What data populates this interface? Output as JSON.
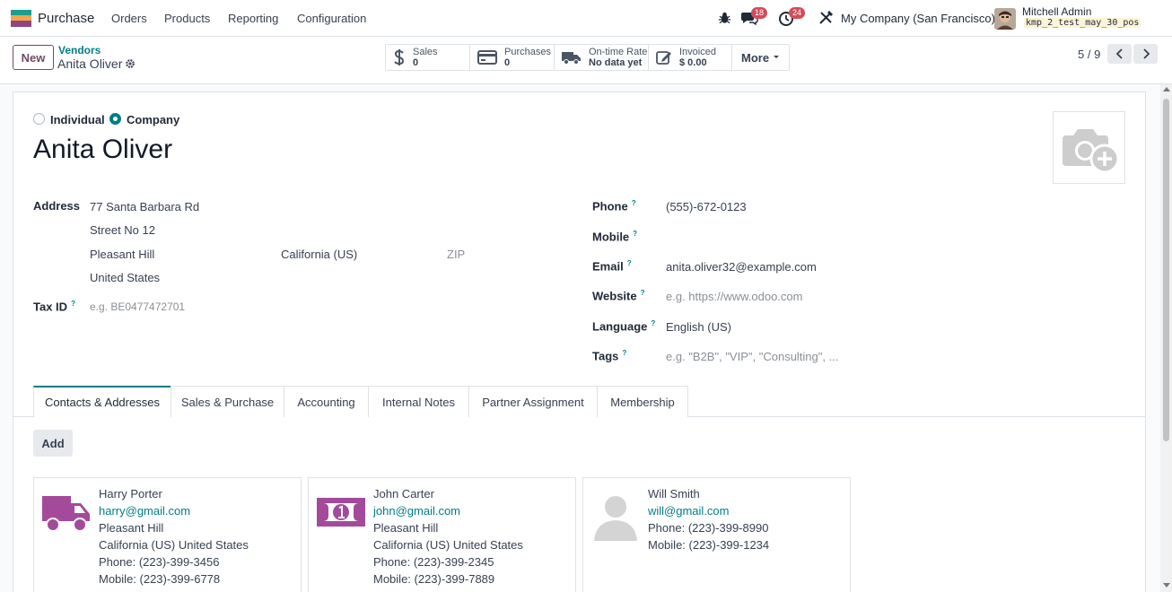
{
  "navbar": {
    "app_name": "Purchase",
    "menu": [
      "Orders",
      "Products",
      "Reporting",
      "Configuration"
    ],
    "icons": [
      "bug-icon",
      "chat-icon",
      "activity-clock-icon",
      "tools-icon"
    ],
    "chat_badge": "18",
    "activity_badge": "24",
    "company": "My Company (San Francisco)",
    "user_name": "Mitchell Admin",
    "db_name": "kmp_2_test_may_30_pos"
  },
  "control": {
    "new_label": "New",
    "breadcrumb_parent": "Vendors",
    "breadcrumb_current": "Anita Oliver",
    "smart_buttons": [
      {
        "icon": "dollar-icon",
        "label": "Sales",
        "value": "0"
      },
      {
        "icon": "credit-card-icon",
        "label": "Purchases",
        "value": "0"
      },
      {
        "icon": "truck-icon",
        "label": "On-time Rate",
        "value": "No data yet"
      },
      {
        "icon": "pencil-square-icon",
        "label": "Invoiced",
        "value": "$ 0.00"
      }
    ],
    "more_label": "More",
    "pager": "5 / 9"
  },
  "form": {
    "type_options": [
      "Individual",
      "Company"
    ],
    "type_selected": "Company",
    "name": "Anita Oliver",
    "address_label": "Address",
    "street": "77 Santa Barbara Rd",
    "street2": "Street No 12",
    "city": "Pleasant Hill",
    "state": "California (US)",
    "zip_placeholder": "ZIP",
    "country": "United States",
    "tax_id_label": "Tax ID",
    "tax_id_placeholder": "e.g. BE0477472701",
    "phone_label": "Phone",
    "phone": "(555)-672-0123",
    "mobile_label": "Mobile",
    "mobile": "",
    "email_label": "Email",
    "email": "anita.oliver32@example.com",
    "website_label": "Website",
    "website_placeholder": "e.g. https://www.odoo.com",
    "language_label": "Language",
    "language": "English (US)",
    "tags_label": "Tags",
    "tags_placeholder": "e.g. \"B2B\", \"VIP\", \"Consulting\", ...",
    "help_mark": "?"
  },
  "tabs": [
    "Contacts & Addresses",
    "Sales & Purchase",
    "Accounting",
    "Internal Notes",
    "Partner Assignment",
    "Membership"
  ],
  "add_label": "Add",
  "contacts": [
    {
      "image": "truck-icon",
      "name": "Harry Porter",
      "email": "harry@gmail.com",
      "city": "Pleasant Hill",
      "region": "California (US) United States",
      "phone": "Phone: (223)-399-3456",
      "mobile": "Mobile: (223)-399-6778"
    },
    {
      "image": "money-bill-icon",
      "name": "John Carter",
      "email": "john@gmail.com",
      "city": "Pleasant Hill",
      "region": "California (US) United States",
      "phone": "Phone: (223)-399-2345",
      "mobile": "Mobile: (223)-399-7889"
    },
    {
      "image": "person-placeholder-icon",
      "name": "Will Smith",
      "email": "will@gmail.com",
      "phone": "Phone: (223)-399-8990",
      "mobile": "Mobile: (223)-399-1234"
    }
  ],
  "colors": {
    "brand": "#714b67",
    "teal": "#017e84",
    "badge": "#d44c59"
  }
}
